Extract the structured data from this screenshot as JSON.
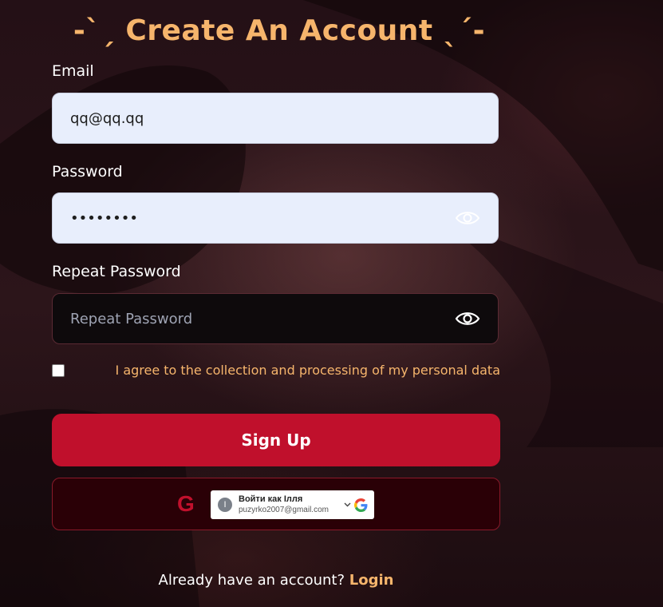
{
  "title": "-ˋˏ Create An Account ˎˊ-",
  "email": {
    "label": "Email",
    "value": "qq@qq.qq"
  },
  "password": {
    "label": "Password",
    "value": "••••••••"
  },
  "repeat_password": {
    "label": "Repeat Password",
    "placeholder": "Repeat Password"
  },
  "consent": {
    "text": "I agree to the collection and processing of my personal data",
    "checked": false
  },
  "signup": {
    "label": "Sign Up"
  },
  "google": {
    "letter": "G",
    "account_name": "Войти как Ілля",
    "account_email": "puzyrko2007@gmail.com",
    "avatar_letter": "І"
  },
  "footer": {
    "text": "Already have an account? ",
    "link": "Login"
  },
  "colors": {
    "accent": "#f6b56c",
    "primary": "#c0102c"
  }
}
